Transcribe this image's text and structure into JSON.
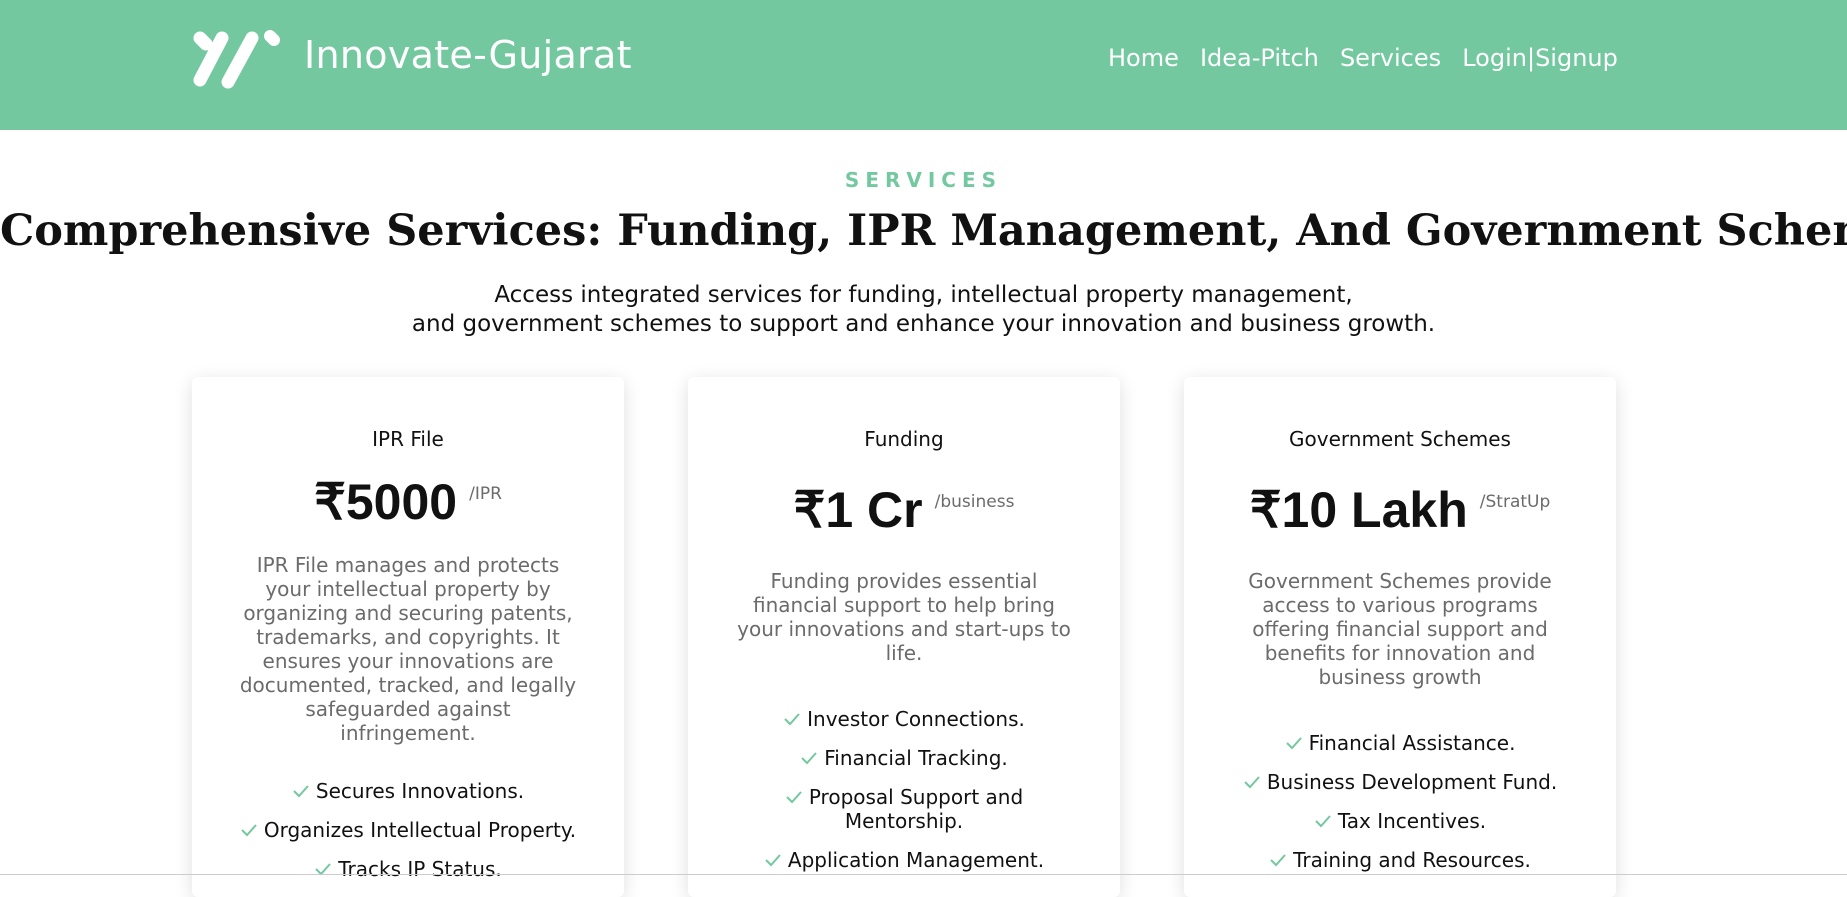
{
  "header": {
    "brand": "Innovate-Gujarat",
    "nav": [
      "Home",
      "Idea-Pitch",
      "Services",
      "Login|Signup"
    ]
  },
  "hero": {
    "eyebrow": "SERVICES",
    "headline": "Comprehensive Services: Funding, IPR Management, And Government Scheme.",
    "subtitle_line1": "Access integrated services for funding, intellectual property management,",
    "subtitle_line2": "and government schemes to support and enhance your innovation and business growth."
  },
  "cards": [
    {
      "title": "IPR File",
      "price": "₹5000",
      "unit": "/IPR",
      "description": "IPR File manages and protects your intellectual property by organizing and securing patents, trademarks, and copyrights. It ensures your innovations are documented, tracked, and legally safeguarded against infringement.",
      "features": [
        "Secures Innovations.",
        "Organizes Intellectual Property.",
        "Tracks IP Status."
      ]
    },
    {
      "title": "Funding",
      "price": "₹1 Cr",
      "unit": "/business",
      "description": "Funding provides essential financial support to help bring your innovations and start-ups to life.",
      "features": [
        "Investor Connections.",
        "Financial Tracking.",
        "Proposal Support and Mentorship.",
        "Application Management."
      ]
    },
    {
      "title": "Government Schemes",
      "price": "₹10 Lakh",
      "unit": "/StratUp",
      "description": "Government Schemes provide access to various programs offering financial support and benefits for innovation and business growth",
      "features": [
        "Financial Assistance.",
        "Business Development Fund.",
        "Tax Incentives.",
        "Training and Resources."
      ]
    }
  ],
  "colors": {
    "accent": "#74c8a0",
    "muted_text": "#6b6b6b",
    "text": "#111111"
  },
  "icons": {
    "logo": "brand-logo-icon",
    "check": "check-icon"
  }
}
